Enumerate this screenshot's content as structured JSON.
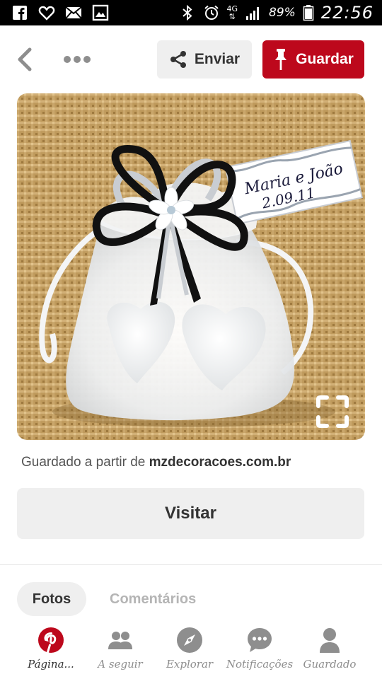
{
  "status_bar": {
    "icons_left": [
      "facebook-icon",
      "heart-icon",
      "mail-icon",
      "image-icon"
    ],
    "network_type": "4G",
    "battery_percent": "89%",
    "time": "22:56"
  },
  "toolbar": {
    "send_label": "Enviar",
    "save_label": "Guardar"
  },
  "pin": {
    "image_alt": "Organza favor bag with two heart-shaped soaps, black and silver ribbon bow and a tag",
    "tag_names": "Maria e João",
    "tag_date": "2.09.11"
  },
  "source": {
    "prefix": "Guardado a partir de",
    "domain": "mzdecoracoes.com.br"
  },
  "visit_label": "Visitar",
  "tabs": [
    {
      "label": "Fotos",
      "active": true
    },
    {
      "label": "Comentários",
      "active": false
    }
  ],
  "bottom_nav": [
    {
      "label": "Página...",
      "icon": "pinterest-logo-icon",
      "active": true
    },
    {
      "label": "A seguir",
      "icon": "people-icon",
      "active": false
    },
    {
      "label": "Explorar",
      "icon": "compass-icon",
      "active": false
    },
    {
      "label": "Notificações",
      "icon": "speech-bubble-icon",
      "active": false
    },
    {
      "label": "Guardado",
      "icon": "person-icon",
      "active": false
    }
  ],
  "colors": {
    "brand_red": "#bd081c",
    "button_gray": "#efefef",
    "status_bar": "#000000"
  }
}
